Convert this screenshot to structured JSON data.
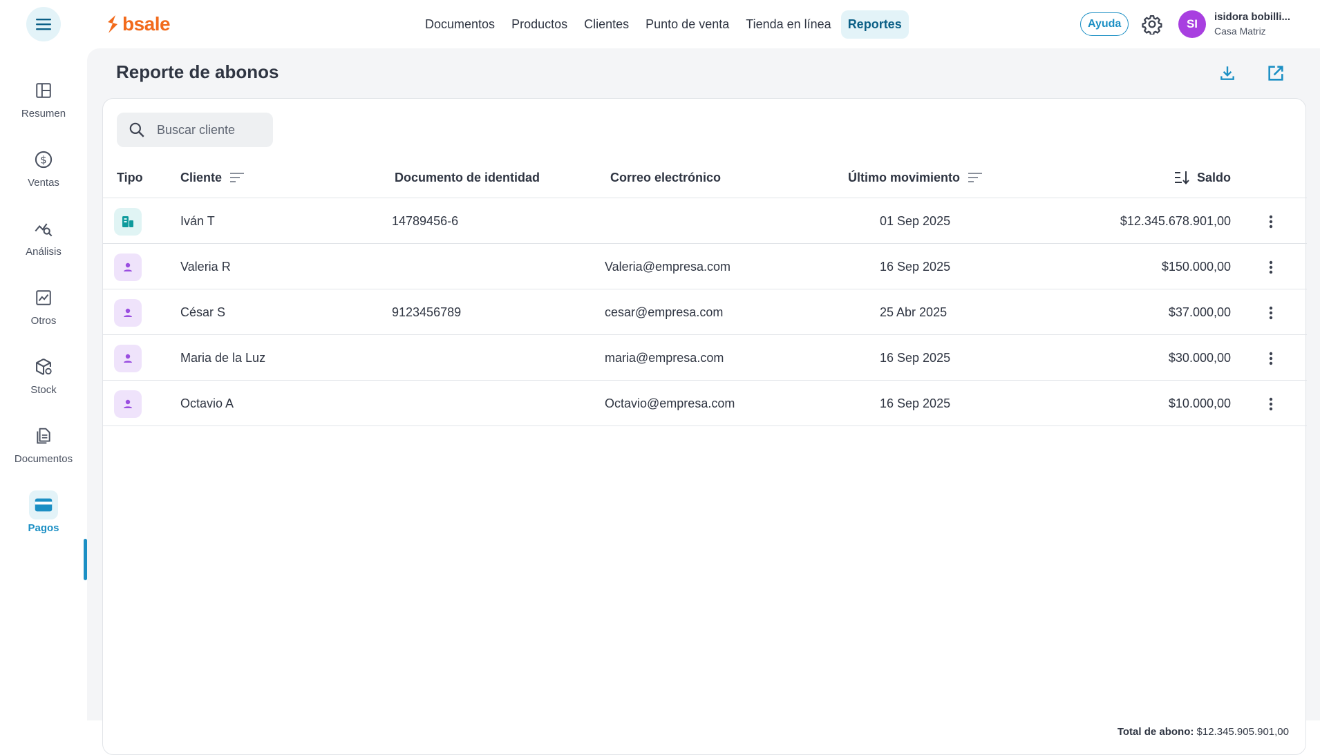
{
  "colors": {
    "brand": "#f26a1b",
    "accent": "#1b8fc4",
    "avatar": "#a83fe0"
  },
  "header": {
    "logo_text": "bsale",
    "nav": [
      {
        "label": "Documentos"
      },
      {
        "label": "Productos"
      },
      {
        "label": "Clientes"
      },
      {
        "label": "Punto de venta"
      },
      {
        "label": "Tienda en línea"
      },
      {
        "label": "Reportes",
        "active": true
      }
    ],
    "help_label": "Ayuda",
    "user": {
      "initials": "SI",
      "name": "isidora bobilli...",
      "branch": "Casa Matriz"
    },
    "icons": {
      "menu": "menu-icon",
      "settings": "gear-icon"
    }
  },
  "sidebar": {
    "items": [
      {
        "label": "Resumen",
        "icon": "layout-icon"
      },
      {
        "label": "Ventas",
        "icon": "dollar-circle-icon"
      },
      {
        "label": "Análisis",
        "icon": "chart-search-icon"
      },
      {
        "label": "Otros",
        "icon": "trend-chart-icon"
      },
      {
        "label": "Stock",
        "icon": "box-icon"
      },
      {
        "label": "Documentos",
        "icon": "document-icon"
      },
      {
        "label": "Pagos",
        "icon": "card-icon",
        "active": true
      }
    ]
  },
  "main": {
    "title": "Reporte de abonos",
    "actions": {
      "download": "download-icon",
      "open": "open-external-icon"
    },
    "search": {
      "placeholder": "Buscar cliente",
      "value": ""
    },
    "columns": {
      "tipo": "Tipo",
      "cliente": "Cliente",
      "documento": "Documento de identidad",
      "correo": "Correo electrónico",
      "ultimo": "Último movimiento",
      "saldo": "Saldo"
    },
    "rows": [
      {
        "type": "company",
        "cliente": "Iván T",
        "documento": "14789456-6",
        "correo": "",
        "ultimo": "01 Sep 2025",
        "saldo": "$12.345.678.901,00"
      },
      {
        "type": "person",
        "cliente": "Valeria R",
        "documento": "",
        "correo": "Valeria@empresa.com",
        "ultimo": "16 Sep 2025",
        "saldo": "$150.000,00"
      },
      {
        "type": "person",
        "cliente": "César S",
        "documento": "9123456789",
        "correo": "cesar@empresa.com",
        "ultimo": "25 Abr 2025",
        "saldo": "$37.000,00"
      },
      {
        "type": "person",
        "cliente": "Maria de la Luz",
        "documento": "",
        "correo": "maria@empresa.com",
        "ultimo": "16 Sep 2025",
        "saldo": "$30.000,00"
      },
      {
        "type": "person",
        "cliente": "Octavio A",
        "documento": "",
        "correo": "Octavio@empresa.com",
        "ultimo": "16 Sep 2025",
        "saldo": "$10.000,00"
      }
    ],
    "total_label": "Total de abono:",
    "total_value": "$12.345.905.901,00"
  }
}
